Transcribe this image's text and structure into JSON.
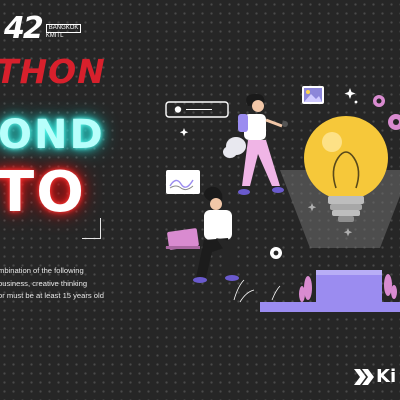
{
  "logo": {
    "number": "42",
    "line1": "BANGKOK",
    "line2": "KMITL"
  },
  "headline": {
    "line1": "THON",
    "line2": "OND",
    "line3": "TO"
  },
  "description": {
    "lines": [
      "mbination of the following",
      "business, creative thinking",
      "or must be at least 15 years old"
    ]
  },
  "brand": {
    "text": "Ki"
  },
  "colors": {
    "background": "#262626",
    "hack_red": "#d8202c",
    "beyond_cyan": "#b6fffb",
    "bulb_yellow": "#f6c83a",
    "purple": "#9b8cf0"
  },
  "icons": [
    "search-bar-icon",
    "image-icon",
    "sparkle-icon",
    "gear-icon",
    "chart-card-icon",
    "lightbulb-icon",
    "laptop-icon"
  ]
}
